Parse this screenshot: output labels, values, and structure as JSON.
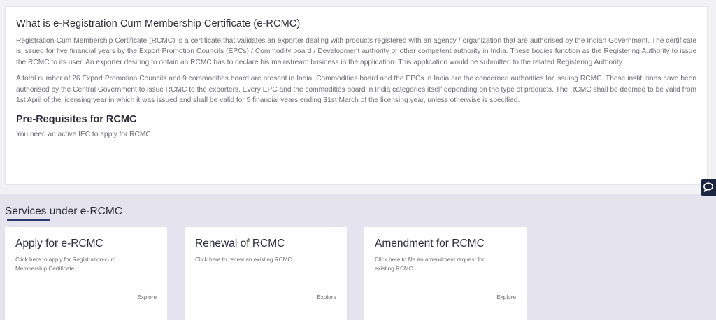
{
  "info": {
    "title": "What is e-Registration Cum Membership Certificate (e-RCMC)",
    "para1": "Registration-Cum Membership Certificate (RCMC) is a certificate that validates an exporter dealing with products registered with an agency / organization that are authorised by the Indian Government. The certificate is issued for five financial years by the Export Promotion Councils (EPCs) / Commodity board / Development authority or other competent authority in India. These bodies function as the Registering Authority to issue the RCMC to its user. An exporter desiring to obtain an RCMC has to declare his mainstream business in the application. This application would be submitted to the related Registering Authority.",
    "para2": "A total number of 26 Export Promotion Councils and 9 commodities board are present in India. Commodities board and the EPCs in India are the concerned authorities for issuing RCMC. These institutions have been authorised by the Central Government to issue RCMC to the exporters. Every EPC and the commodities board in India categories itself depending on the type of products. The RCMC shall be deemed to be valid from 1st April of the licensing year in which it was issued and shall be valid for 5 financial years ending 31st March of the licensing year, unless otherwise is specified.",
    "prereq_title": "Pre-Requisites for RCMC",
    "prereq_text": "You need an active IEC to apply for RCMC."
  },
  "services": {
    "title": "Services under e-RCMC",
    "cards": [
      {
        "title": "Apply for e-RCMC",
        "desc": "Click here to apply for Registration-cum Membership Certificate.",
        "explore": "Explore"
      },
      {
        "title": "Renewal of RCMC",
        "desc": "Click here to renew an existing RCMC.",
        "explore": "Explore"
      },
      {
        "title": "Amendment for RCMC",
        "desc": "Click here to file an amendment request for existing RCMC.",
        "explore": "Explore"
      }
    ]
  },
  "icons": {
    "chat": "chat-icon"
  },
  "colors": {
    "accent": "#2b3a6c",
    "chat_bg": "#1c2540",
    "section_bg": "#e4e3ee"
  }
}
